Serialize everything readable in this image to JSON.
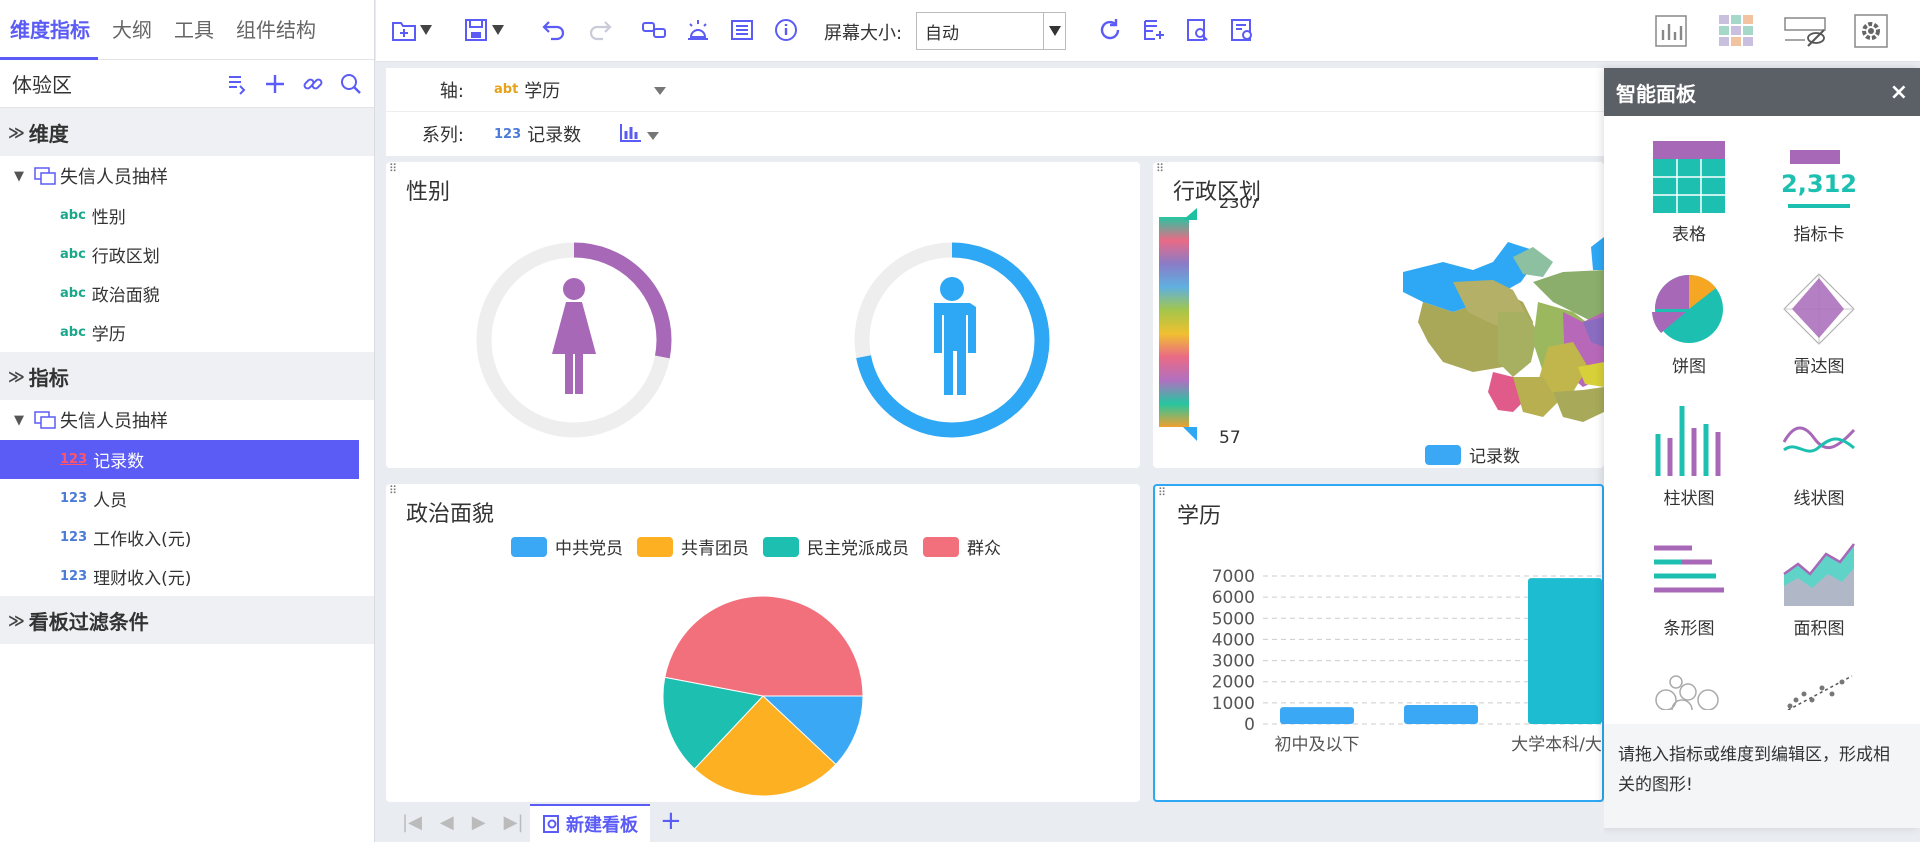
{
  "left": {
    "tabs": [
      "维度指标",
      "大纲",
      "工具",
      "组件结构"
    ],
    "area_title": "体验区",
    "sections": {
      "dimensions": "维度",
      "metrics": "指标",
      "filters": "看板过滤条件"
    },
    "dim_group": "失信人员抽样",
    "dim_fields": [
      "性别",
      "行政区划",
      "政治面貌",
      "学历"
    ],
    "metric_group": "失信人员抽样",
    "metric_fields": [
      "记录数",
      "人员",
      "工作收入(元)",
      "理财收入(元)"
    ],
    "type_tags": {
      "abc": "abc",
      "num": "123"
    }
  },
  "toolbar": {
    "screen_size_label": "屏幕大小:",
    "screen_size_value": "自动"
  },
  "axisbar": {
    "axis_label": "轴:",
    "axis_tag": "abt",
    "axis_value": "学历",
    "series_label": "系列:",
    "series_tag": "123",
    "series_value": "记录数"
  },
  "panels": {
    "gender": {
      "title": "性别",
      "female_ratio": 0.28,
      "male_ratio": 0.72,
      "female_color": "#a868b8",
      "male_color": "#2ea8f4"
    },
    "region": {
      "title": "行政区划",
      "max_label": "2307",
      "min_label": "57",
      "legend": "记录数"
    },
    "politics": {
      "title": "政治面貌"
    },
    "education": {
      "title": "学历"
    }
  },
  "chart_data": [
    {
      "type": "pie",
      "title": "政治面貌",
      "categories": [
        "中共党员",
        "共青团员",
        "民主党派成员",
        "群众"
      ],
      "values": [
        12,
        25,
        16,
        47
      ],
      "colors": [
        "#3aa8f5",
        "#fdb022",
        "#1dc0b0",
        "#f2707c"
      ]
    },
    {
      "type": "bar",
      "title": "学历",
      "categories": [
        "初中及以下",
        "",
        "大学本科/大学"
      ],
      "values": [
        800,
        900,
        6900
      ],
      "ylim": [
        0,
        7000
      ],
      "yticks": [
        0,
        1000,
        2000,
        3000,
        4000,
        5000,
        6000,
        7000
      ],
      "colors": [
        "#3aa8f5",
        "#3aa8f5",
        "#1dbcd0"
      ]
    }
  ],
  "smart_panel": {
    "title": "智能面板",
    "close": "×",
    "types": [
      "表格",
      "指标卡",
      "饼图",
      "雷达图",
      "柱状图",
      "线状图",
      "条形图",
      "面积图"
    ],
    "card_value": "2,312",
    "hint": "请拖入指标或维度到编辑区，形成相关的图形!"
  },
  "bottom": {
    "tab": "新建看板"
  }
}
